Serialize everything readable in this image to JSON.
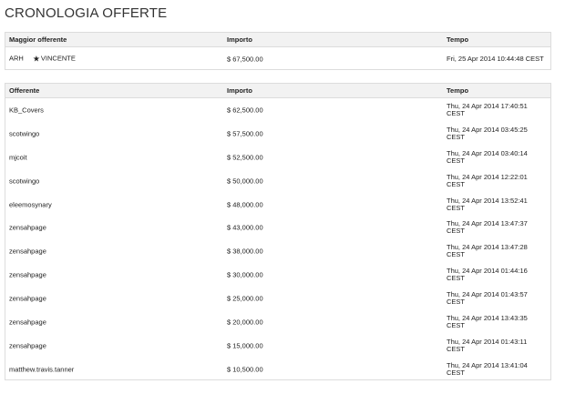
{
  "page": {
    "title": "CRONOLOGIA OFFERTE"
  },
  "winner": {
    "headers": {
      "bidder": "Maggior offerente",
      "amount": "Importo",
      "time": "Tempo"
    },
    "row": {
      "bidder": "ARH",
      "badge_icon": "star-icon",
      "badge_label": "VINCENTE",
      "amount": "$ 67,500.00",
      "time": "Fri, 25 Apr 2014 10:44:48 CEST"
    }
  },
  "bids": {
    "headers": {
      "bidder": "Offerente",
      "amount": "Importo",
      "time": "Tempo"
    },
    "rows": [
      {
        "bidder": "KB_Covers",
        "amount": "$ 62,500.00",
        "time": "Thu, 24 Apr 2014 17:40:51 CEST"
      },
      {
        "bidder": "scotwingo",
        "amount": "$ 57,500.00",
        "time": "Thu, 24 Apr 2014 03:45:25 CEST"
      },
      {
        "bidder": "mjcoit",
        "amount": "$ 52,500.00",
        "time": "Thu, 24 Apr 2014 03:40:14 CEST"
      },
      {
        "bidder": "scotwingo",
        "amount": "$ 50,000.00",
        "time": "Thu, 24 Apr 2014 12:22:01 CEST"
      },
      {
        "bidder": "eleemosynary",
        "amount": "$ 48,000.00",
        "time": "Thu, 24 Apr 2014 13:52:41 CEST"
      },
      {
        "bidder": "zensahpage",
        "amount": "$ 43,000.00",
        "time": "Thu, 24 Apr 2014 13:47:37 CEST"
      },
      {
        "bidder": "zensahpage",
        "amount": "$ 38,000.00",
        "time": "Thu, 24 Apr 2014 13:47:28 CEST"
      },
      {
        "bidder": "zensahpage",
        "amount": "$ 30,000.00",
        "time": "Thu, 24 Apr 2014 01:44:16 CEST"
      },
      {
        "bidder": "zensahpage",
        "amount": "$ 25,000.00",
        "time": "Thu, 24 Apr 2014 01:43:57 CEST"
      },
      {
        "bidder": "zensahpage",
        "amount": "$ 20,000.00",
        "time": "Thu, 24 Apr 2014 13:43:35 CEST"
      },
      {
        "bidder": "zensahpage",
        "amount": "$ 15,000.00",
        "time": "Thu, 24 Apr 2014 01:43:11 CEST"
      },
      {
        "bidder": "matthew.travis.tanner",
        "amount": "$ 10,500.00",
        "time": "Thu, 24 Apr 2014 13:41:04 CEST"
      }
    ]
  }
}
